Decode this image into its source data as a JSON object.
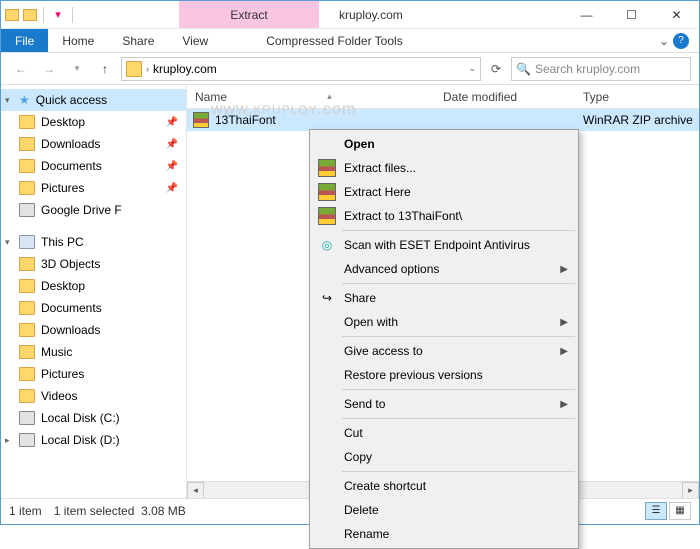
{
  "titlebar": {
    "contextual_tab": "Extract",
    "title": "kruploy.com"
  },
  "ribbon": {
    "file": "File",
    "home": "Home",
    "share": "Share",
    "view": "View",
    "tools": "Compressed Folder Tools"
  },
  "nav": {
    "crumb": "kruploy.com",
    "search_placeholder": "Search kruploy.com"
  },
  "sidebar": {
    "quick_access": "Quick access",
    "items1": [
      {
        "label": "Desktop"
      },
      {
        "label": "Downloads"
      },
      {
        "label": "Documents"
      },
      {
        "label": "Pictures"
      },
      {
        "label": "Google Drive F"
      }
    ],
    "this_pc": "This PC",
    "items2": [
      {
        "label": "3D Objects"
      },
      {
        "label": "Desktop"
      },
      {
        "label": "Documents"
      },
      {
        "label": "Downloads"
      },
      {
        "label": "Music"
      },
      {
        "label": "Pictures"
      },
      {
        "label": "Videos"
      },
      {
        "label": "Local Disk (C:)"
      },
      {
        "label": "Local Disk (D:)"
      }
    ]
  },
  "columns": {
    "name": "Name",
    "date": "Date modified",
    "type": "Type"
  },
  "row": {
    "name": "13ThaiFont",
    "type": "WinRAR ZIP archive"
  },
  "context": {
    "open": "Open",
    "extract_files": "Extract files...",
    "extract_here": "Extract Here",
    "extract_to": "Extract to 13ThaiFont\\",
    "scan": "Scan with ESET Endpoint Antivirus",
    "adv": "Advanced options",
    "share": "Share",
    "open_with": "Open with",
    "give_access": "Give access to",
    "restore": "Restore previous versions",
    "send_to": "Send to",
    "cut": "Cut",
    "copy": "Copy",
    "shortcut": "Create shortcut",
    "delete": "Delete",
    "rename": "Rename"
  },
  "status": {
    "count": "1 item",
    "selected": "1 item selected",
    "size": "3.08 MB"
  },
  "watermark": {
    "prefix": "www.",
    "main": "KRUPLOY",
    "suffix": ".com"
  }
}
